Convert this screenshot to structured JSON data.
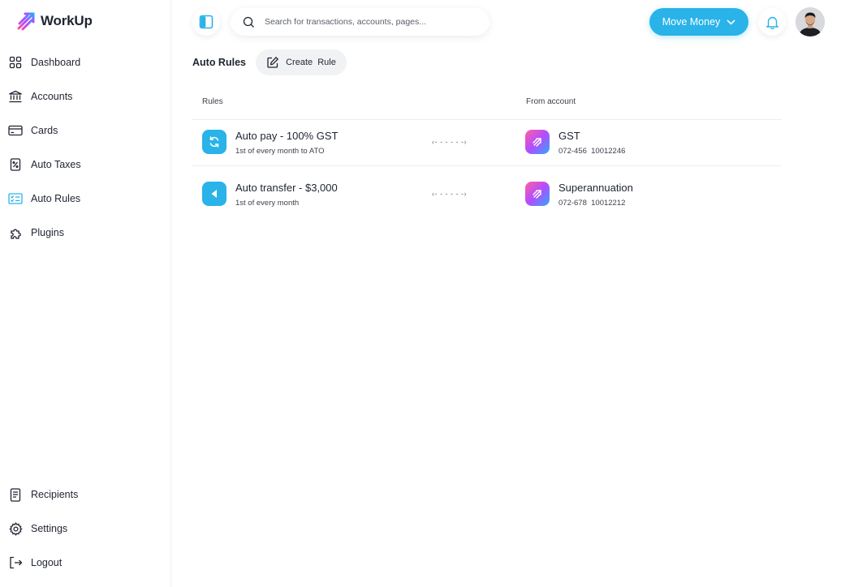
{
  "app": {
    "name": "WorkUp"
  },
  "sidebar": {
    "items": [
      {
        "label": "Dashboard",
        "icon": "grid-icon"
      },
      {
        "label": "Accounts",
        "icon": "bank-icon"
      },
      {
        "label": "Cards",
        "icon": "card-icon"
      },
      {
        "label": "Auto Taxes",
        "icon": "tax-receipt-icon"
      },
      {
        "label": "Auto Rules",
        "icon": "checklist-icon"
      },
      {
        "label": "Plugins",
        "icon": "puzzle-icon"
      }
    ],
    "bottom_items": [
      {
        "label": "Recipients",
        "icon": "document-icon"
      },
      {
        "label": "Settings",
        "icon": "gear-icon"
      },
      {
        "label": "Logout",
        "icon": "logout-icon"
      }
    ],
    "active": "Auto Rules"
  },
  "header": {
    "search_placeholder": "Search for transactions, accounts, pages...",
    "move_money_label": "Move Money"
  },
  "page": {
    "title": "Auto Rules",
    "create_label": "Create  Rule"
  },
  "table": {
    "col_rules": "Rules",
    "col_from": "From account",
    "rows": [
      {
        "title": "Auto pay - 100% GST",
        "subtitle": "1st of every month to ATO",
        "arrow": "‹- - - - - -›",
        "account_name": "GST",
        "account_number": "072-456  10012246",
        "icon": "refresh-icon"
      },
      {
        "title": "Auto transfer - $3,000",
        "subtitle": "1st of every month",
        "arrow": "‹- - - - - -›",
        "account_name": "Superannuation",
        "account_number": "072-678  10012212",
        "icon": "play-left-icon"
      }
    ]
  },
  "colors": {
    "accent": "#29b3e8",
    "text": "#1f2430"
  }
}
